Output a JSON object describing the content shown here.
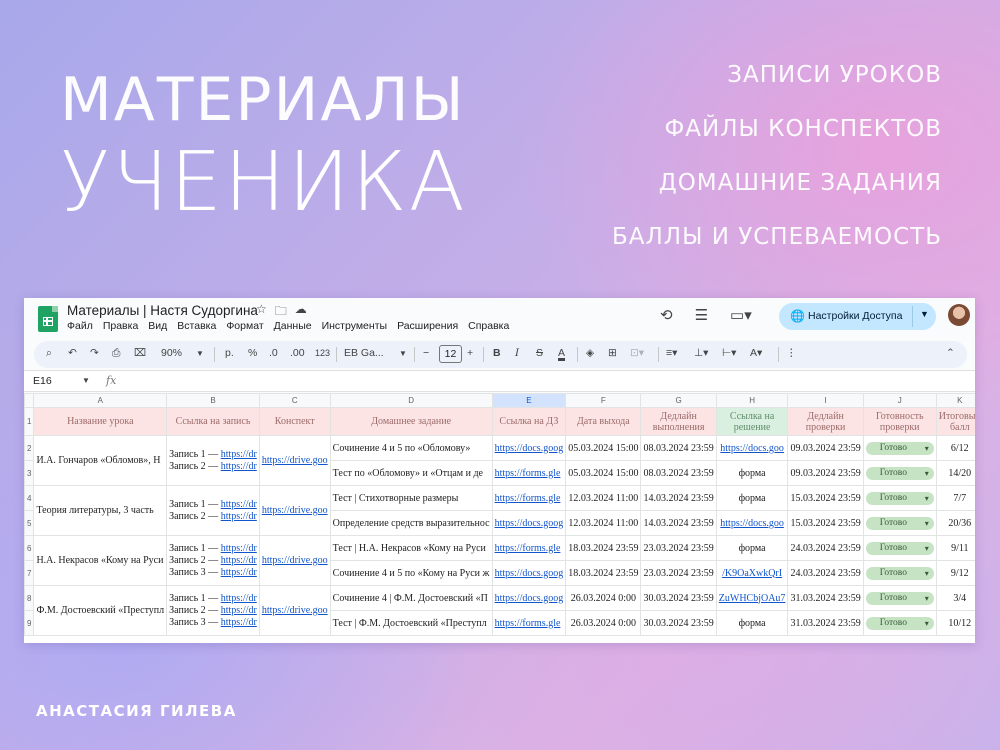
{
  "hero": {
    "title_line1": "МАТЕРИАЛЫ",
    "title_line2": "УЧЕНИКА",
    "features": [
      "ЗАПИСИ УРОКОВ",
      "ФАЙЛЫ КОНСПЕКТОВ",
      "ДОМАШНИЕ ЗАДАНИЯ",
      "БАЛЛЫ И УСПЕВАЕМОСТЬ"
    ],
    "author": "АНАСТАСИЯ ГИЛЕВА"
  },
  "app": {
    "doc_title": "Материалы | Настя Судоргина",
    "menu": [
      "Файл",
      "Правка",
      "Вид",
      "Вставка",
      "Формат",
      "Данные",
      "Инструменты",
      "Расширения",
      "Справка"
    ],
    "share_label": "Настройки Доступа",
    "icons": {
      "history": "history-icon",
      "comments": "comment-icon",
      "meet": "video-icon",
      "share": "globe-icon"
    }
  },
  "toolbar": {
    "zoom": "90%",
    "currency": "р.",
    "percent": "%",
    "dec_less": ".0",
    "dec_more": ".00",
    "number_format": "123",
    "font": "EB Ga...",
    "font_size": "12"
  },
  "formula_bar": {
    "cell_ref": "E16",
    "fx": "fx"
  },
  "sheet": {
    "columns": [
      "A",
      "B",
      "C",
      "D",
      "E",
      "F",
      "G",
      "H",
      "I",
      "J",
      "K"
    ],
    "selected_column": "E",
    "header_row_number": "1",
    "headers": [
      "Название урока",
      "Ссылка на запись",
      "Конспект",
      "Домашнее задание",
      "Ссылка на ДЗ",
      "Дата выхода",
      "Дедлайн выполнения",
      "Ссылка на решение",
      "Дедлайн проверки",
      "Готовность проверки",
      "Итоговый балл"
    ],
    "lessons": [
      {
        "rows": [
          "2",
          "3"
        ],
        "title": "И.А. Гончаров «Обломов», Н",
        "records": [
          "Запись 1 — ",
          "Запись 2 — "
        ],
        "record_link": "https://dr",
        "notes": "https://drive.goo",
        "tasks": [
          {
            "hw": "Сочинение 4 и 5 по «Обломову»",
            "hw_link": "https://docs.goog",
            "release": "05.03.2024 15:00",
            "deadline": "08.03.2024 23:59",
            "solution": "https://docs.goo",
            "solution_is_link": true,
            "check": "09.03.2024 23:59",
            "status": "Готово",
            "score": "6/12"
          },
          {
            "hw": "Тест по «Обломову» и «Отцам и де",
            "hw_link": "https://forms.gle",
            "release": "05.03.2024 15:00",
            "deadline": "08.03.2024 23:59",
            "solution": "форма",
            "solution_is_link": false,
            "check": "09.03.2024 23:59",
            "status": "Готово",
            "score": "14/20"
          }
        ]
      },
      {
        "rows": [
          "4",
          "5"
        ],
        "title": "Теория литературы, 3 часть",
        "records": [
          "Запись 1 — ",
          "Запись 2 — "
        ],
        "record_link": "https://dr",
        "notes": "https://drive.goo",
        "tasks": [
          {
            "hw": "Тест | Стихотворные размеры",
            "hw_link": "https://forms.gle",
            "release": "12.03.2024 11:00",
            "deadline": "14.03.2024 23:59",
            "solution": "форма",
            "solution_is_link": false,
            "check": "15.03.2024 23:59",
            "status": "Готово",
            "score": "7/7"
          },
          {
            "hw": "Определение средств выразительнос",
            "hw_link": "https://docs.goog",
            "release": "12.03.2024 11:00",
            "deadline": "14.03.2024 23:59",
            "solution": "https://docs.goo",
            "solution_is_link": true,
            "check": "15.03.2024 23:59",
            "status": "Готово",
            "score": "20/36"
          }
        ]
      },
      {
        "rows": [
          "6",
          "7"
        ],
        "title": "Н.А. Некрасов «Кому на Руси",
        "records": [
          "Запись 1 — ",
          "Запись 2 — ",
          "Запись 3 — "
        ],
        "record_link": "https://dr",
        "notes": "https://drive.goo",
        "tasks": [
          {
            "hw": "Тест | Н.А. Некрасов «Кому на Руси",
            "hw_link": "https://forms.gle",
            "release": "18.03.2024 23:59",
            "deadline": "23.03.2024 23:59",
            "solution": "форма",
            "solution_is_link": false,
            "check": "24.03.2024 23:59",
            "status": "Готово",
            "score": "9/11"
          },
          {
            "hw": "Сочинение 4 и 5 по «Кому на Руси ж",
            "hw_link": "https://docs.goog",
            "release": "18.03.2024 23:59",
            "deadline": "23.03.2024 23:59",
            "solution": "/K9OaXwkQrI",
            "solution_is_link": true,
            "check": "24.03.2024 23:59",
            "status": "Готово",
            "score": "9/12"
          }
        ]
      },
      {
        "rows": [
          "8",
          "9"
        ],
        "title": "Ф.М. Достоевский «Преступл",
        "records": [
          "Запись 1 — ",
          "Запись 2 — ",
          "Запись 3 — "
        ],
        "record_link": "https://dr",
        "notes": "https://drive.goo",
        "tasks": [
          {
            "hw": "Сочинение 4 | Ф.М. Достоевский «П",
            "hw_link": "https://docs.goog",
            "release": "26.03.2024 0:00",
            "deadline": "30.03.2024 23:59",
            "solution": "ZuWHCbjOAu7",
            "solution_is_link": true,
            "check": "31.03.2024 23:59",
            "status": "Готово",
            "score": "3/4"
          },
          {
            "hw": "Тест | Ф.М. Достоевский «Преступл",
            "hw_link": "https://forms.gle",
            "release": "26.03.2024 0:00",
            "deadline": "30.03.2024 23:59",
            "solution": "форма",
            "solution_is_link": false,
            "check": "31.03.2024 23:59",
            "status": "Готово",
            "score": "10/12"
          }
        ]
      }
    ]
  },
  "colors": {
    "header_bg": "#fce4e4",
    "header_green_bg": "#d9f0e0",
    "chip_bg": "#c6e4c4",
    "link": "#1155cc",
    "share_btn": "#c2e7ff",
    "sheets_green": "#1ea362"
  }
}
